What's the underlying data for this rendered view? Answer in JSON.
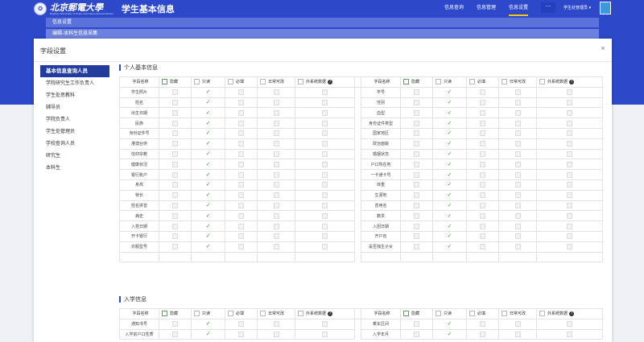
{
  "header": {
    "school_name": "北京郵電大學",
    "school_subtitle": "Beijing University of Posts and Telecommunications",
    "app_title": "学生基本信息",
    "nav": [
      "信息查询",
      "信息管理",
      "信息设置"
    ],
    "active_nav": "信息设置",
    "more_label": "···",
    "user_label": "学生处管理员 ▾"
  },
  "breadcrumbs": [
    "信息设置",
    "编辑-本科生信息采集"
  ],
  "modal": {
    "title": "字段设置",
    "close": "×"
  },
  "sidebar": {
    "items": [
      "基本信息查询人员",
      "学院研究生工作负责人",
      "学生处思教科",
      "辅导员",
      "学院负责人",
      "学生处管理员",
      "学校查询人员",
      "研究生",
      "本科生"
    ],
    "active": "基本信息查询人员"
  },
  "columns": [
    "字段名称",
    "隐藏",
    "只读",
    "必填",
    "日常可改",
    "外系统数据"
  ],
  "sections": [
    {
      "title": "个人基本信息",
      "left": [
        "学生照片",
        "姓名",
        "出生日期",
        "民族",
        "身份证件号",
        "港澳台侨",
        "信仰宗教",
        "健康状况",
        "银行账户",
        "身高",
        "特长",
        "姓名拼音",
        "病史",
        "入党日期",
        "开卡银行",
        "衣服型号",
        ""
      ],
      "right": [
        "学号",
        "性别",
        "血型",
        "身份证件类型",
        "国家地区",
        "政治面貌",
        "婚姻状态",
        "户口所在地",
        "一卡通卡号",
        "体重",
        "生源地",
        "曾用名",
        "籍贯",
        "入团日期",
        "开户省",
        "是否独生子女",
        ""
      ]
    },
    {
      "title": "入学信息",
      "left": [
        "通知书号",
        "入学前户口性质"
      ],
      "right": [
        "乘车区间",
        "入学年月"
      ]
    }
  ],
  "check_mark": "✓",
  "help_mark": "?"
}
